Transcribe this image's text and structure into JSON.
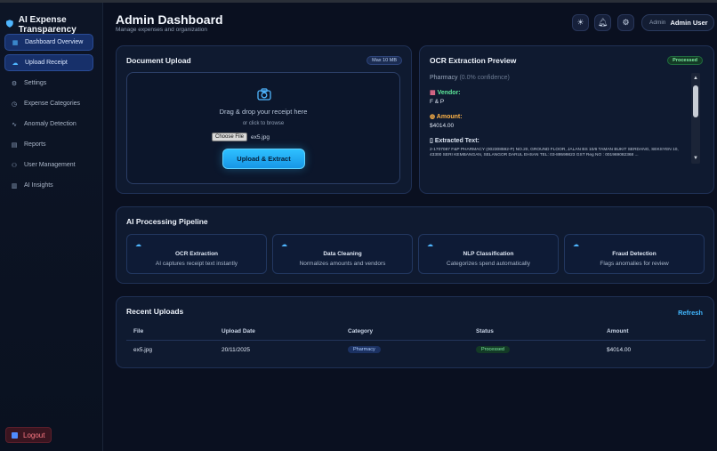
{
  "colors": {
    "accent": "#2ec0ff",
    "success": "#7ff0a3",
    "danger": "#ff7a85",
    "bg": "#0a1020"
  },
  "sidebar": {
    "brand": "AI Expense Transparency",
    "items": [
      {
        "label": "Dashboard Overview",
        "icon": "grid-icon",
        "active": true
      },
      {
        "label": "Upload Receipt",
        "icon": "upload-icon",
        "active": true
      },
      {
        "label": "Settings",
        "icon": "gear-icon"
      },
      {
        "label": "Expense Categories",
        "icon": "tag-icon"
      },
      {
        "label": "Anomaly Detection",
        "icon": "pulse-icon"
      },
      {
        "label": "Reports",
        "icon": "report-icon"
      },
      {
        "label": "User Management",
        "icon": "users-icon"
      },
      {
        "label": "AI Insights",
        "icon": "insights-icon"
      }
    ],
    "logout": "Logout"
  },
  "header": {
    "title": "Admin Dashboard",
    "subtitle": "Manage expenses and organization",
    "user_role": "Admin",
    "user_name": "Admin User"
  },
  "upload": {
    "title": "Document Upload",
    "limit": "Max 10 MB",
    "drag_text": "Drag & drop your receipt here",
    "browse_text": "or click to browse",
    "choose_label": "Choose File",
    "file_name": "ex5.jpg",
    "button": "Upload & Extract"
  },
  "ocr": {
    "title": "OCR Extraction Preview",
    "status": "Processed",
    "category": "Pharmacy",
    "confidence": "(0.0% confidence)",
    "vendor_label": "Vendor:",
    "vendor": "F & P",
    "amount_label": "Amount:",
    "amount": "$4014.00",
    "text_label": "Extracted Text:",
    "text": "2-1707087 F&P PHARMACY (002308592-P) NO.20, GROUND FLOOR, JALAN BS 10/6 TAMAN BUKIT SERDANG, SEKSYEN 10, 43300 SERI KEMBANGAN, SELANGOR DARUL EHSAN TEL: 03-89599823 GST Reg NO : 001969082368 ..."
  },
  "pipeline": {
    "title": "AI Processing Pipeline",
    "steps": [
      {
        "title": "OCR Extraction",
        "desc": "AI captures receipt text instantly"
      },
      {
        "title": "Data Cleaning",
        "desc": "Normalizes amounts and vendors"
      },
      {
        "title": "NLP Classification",
        "desc": "Categorizes spend automatically"
      },
      {
        "title": "Fraud Detection",
        "desc": "Flags anomalies for review"
      }
    ]
  },
  "recent": {
    "title": "Recent Uploads",
    "refresh": "Refresh",
    "columns": [
      "File",
      "Upload Date",
      "Category",
      "Status",
      "Amount"
    ],
    "rows": [
      {
        "file": "ex5.jpg",
        "date": "20/11/2025",
        "category": "Pharmacy",
        "status": "Processed",
        "amount": "$4014.00"
      }
    ]
  }
}
